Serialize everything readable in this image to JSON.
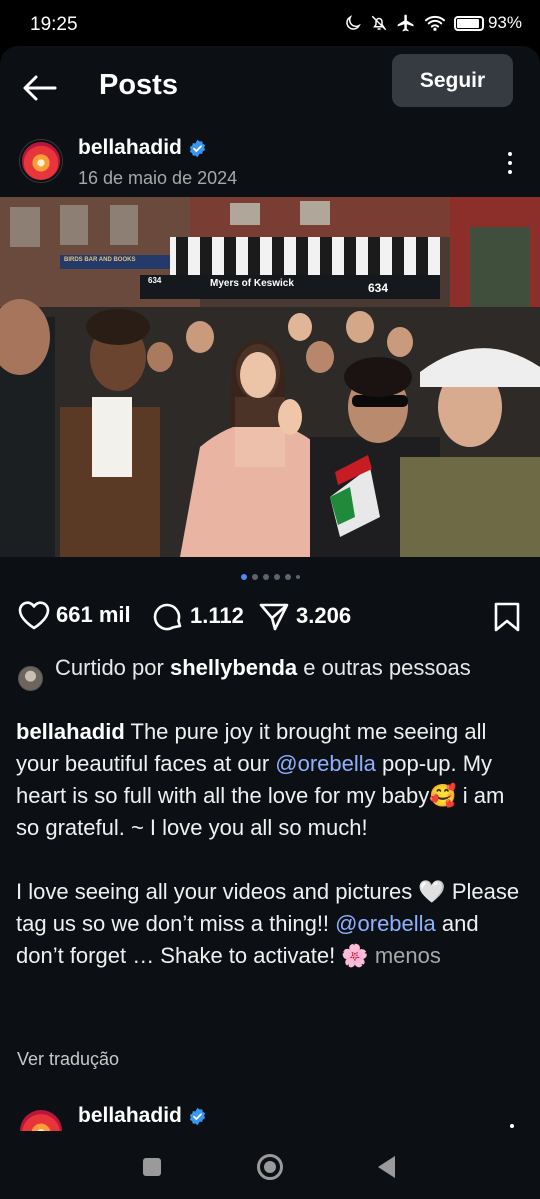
{
  "status_bar": {
    "time": "19:25",
    "battery_percent_label": "93%",
    "battery_level": 0.93,
    "icons": [
      "moon-icon",
      "bell-off-icon",
      "airplane-icon",
      "wifi-icon",
      "battery-icon"
    ]
  },
  "header": {
    "title": "Posts",
    "follow_label": "Seguir"
  },
  "post": {
    "username": "bellahadid",
    "verified": true,
    "date": "16 de maio de 2024",
    "image_signs": {
      "shop_name": "Myers of Keswick",
      "shop_number": "634",
      "bar_sign": "BIRDS BAR AND BOOKS",
      "left_number": "634"
    },
    "carousel": {
      "count": 6,
      "active_index": 0
    },
    "likes": "661 mil",
    "comments": "1.112",
    "shares": "3.206",
    "liked_by": {
      "prefix": "Curtido por",
      "user": "shellybenda",
      "suffix": "e outras pessoas"
    },
    "caption": {
      "user": "bellahadid",
      "part1": " The pure joy it brought me seeing all your beautiful faces at our ",
      "mention1": "@orebella",
      "part2": " pop-up. My heart is so full with all the love for my baby🥰  i am so grateful. ~ I love you all so much!",
      "part3": "I love seeing all your videos and pictures 🤍 Please tag us so we don’t miss a thing!! ",
      "mention2": "@orebella",
      "part4": " and don’t forget … Shake to activate! 🌸 ",
      "less": "menos"
    },
    "translate_label": "Ver tradução"
  },
  "next_post": {
    "username": "bellahadid",
    "verified": true
  },
  "colors": {
    "background": "#0c1014",
    "follow_button": "#363b42",
    "mention": "#8fb0ff",
    "verified": "#3897f0",
    "active_dot": "#4b8cf5"
  }
}
